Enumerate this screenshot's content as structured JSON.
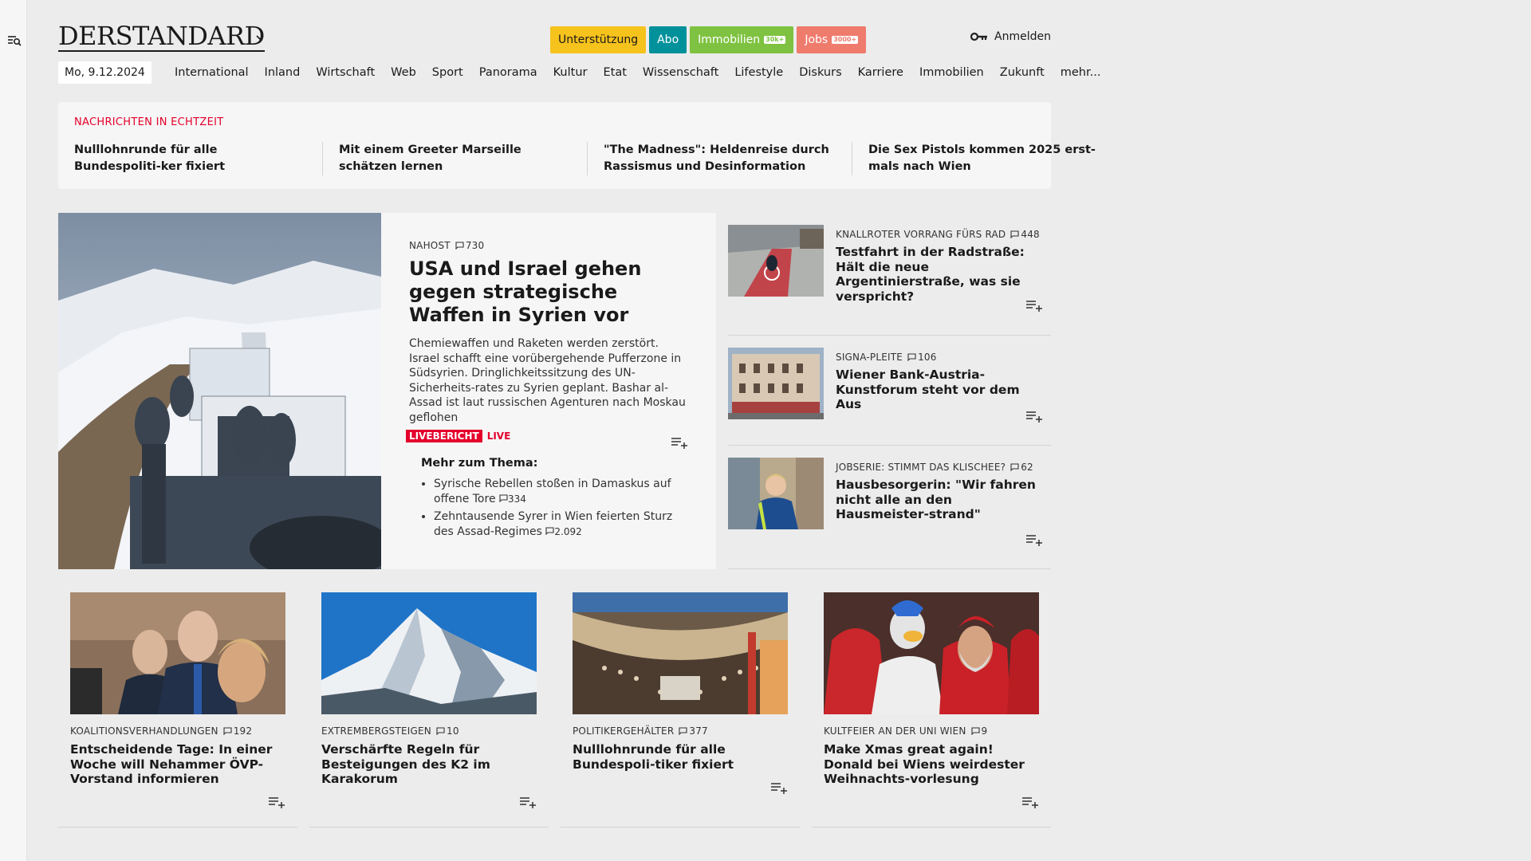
{
  "brand": {
    "logo": "DERSTANDARD"
  },
  "pills": [
    {
      "label": "Unterstützung",
      "badge": "",
      "color": "#f6c21c",
      "text": "#1a1a1a"
    },
    {
      "label": "Abo",
      "badge": "",
      "color": "#00919a",
      "text": "#ffffff"
    },
    {
      "label": "Immobilien",
      "badge": "30k+",
      "color": "#7fc241",
      "text": "#ffffff"
    },
    {
      "label": "Jobs",
      "badge": "3000+",
      "color": "#ef7b6d",
      "text": "#ffffff"
    }
  ],
  "login": {
    "label": "Anmelden"
  },
  "date": "Mo, 9.12.2024",
  "nav": [
    "International",
    "Inland",
    "Wirtschaft",
    "Web",
    "Sport",
    "Panorama",
    "Kultur",
    "Etat",
    "Wissenschaft",
    "Lifestyle",
    "Diskurs",
    "Karriere",
    "Immobilien",
    "Zukunft",
    "mehr..."
  ],
  "ticker": {
    "label": "NACHRICHTEN IN ECHTZEIT",
    "items": [
      "Nulllohnrunde für alle Bundespoliti-ker fixiert",
      "Mit einem Greeter Marseille schätzen lernen",
      "\"The Madness\": Heldenreise durch Rassismus und Desinformation",
      "Die Sex Pistols kommen 2025 erst-mals nach Wien"
    ]
  },
  "hero": {
    "kicker": "NAHOST",
    "comments": "730",
    "title": "USA und Israel gehen gegen strategische Waffen in Syrien vor",
    "teaser": "Chemiewaffen und Raketen werden zerstört. Israel schafft eine vorübergehende Pufferzone in Südsyrien. Dringlichkeitssitzung des UN-Sicherheits-rates zu Syrien geplant. Bashar al-Assad ist laut russischen Agenturen nach Moskau geflohen",
    "tag": "LIVEBERICHT",
    "live": "LIVE",
    "more_title": "Mehr zum Thema:",
    "more": [
      {
        "text": "Syrische Rebellen stoßen in Damaskus auf offene Tore",
        "comments": "334"
      },
      {
        "text": "Zehntausende Syrer in Wien feierten Sturz des Assad-Regimes",
        "comments": "2.092"
      }
    ]
  },
  "side": [
    {
      "kicker": "KNALLROTER VORRANG FÜRS RAD",
      "comments": "448",
      "title": "Testfahrt in der Radstraße: Hält die neue Argentinierstraße, was sie verspricht?"
    },
    {
      "kicker": "SIGNA-PLEITE",
      "comments": "106",
      "title": "Wiener Bank-Austria-Kunstforum steht vor dem Aus"
    },
    {
      "kicker": "JOBSERIE: STIMMT DAS KLISCHEE?",
      "comments": "62",
      "title": "Hausbesorgerin: \"Wir fahren nicht alle an den Hausmeister-strand\""
    }
  ],
  "cards": [
    {
      "kicker": "KOALITIONSVERHANDLUNGEN",
      "comments": "192",
      "title": "Entscheidende Tage: In einer Woche will Nehammer ÖVP-Vorstand informieren"
    },
    {
      "kicker": "EXTREMBERGSTEIGEN",
      "comments": "10",
      "title": "Verschärfte Regeln für Besteigungen des K2 im Karakorum"
    },
    {
      "kicker": "POLITIKERGEHÄLTER",
      "comments": "377",
      "title": "Nulllohnrunde für alle Bundespoli-tiker fixiert"
    },
    {
      "kicker": "KULTFEIER AN DER UNI WIEN",
      "comments": "9",
      "title": "Make Xmas great again! Donald bei Wiens weirdester Weihnachts-vorlesung"
    }
  ]
}
